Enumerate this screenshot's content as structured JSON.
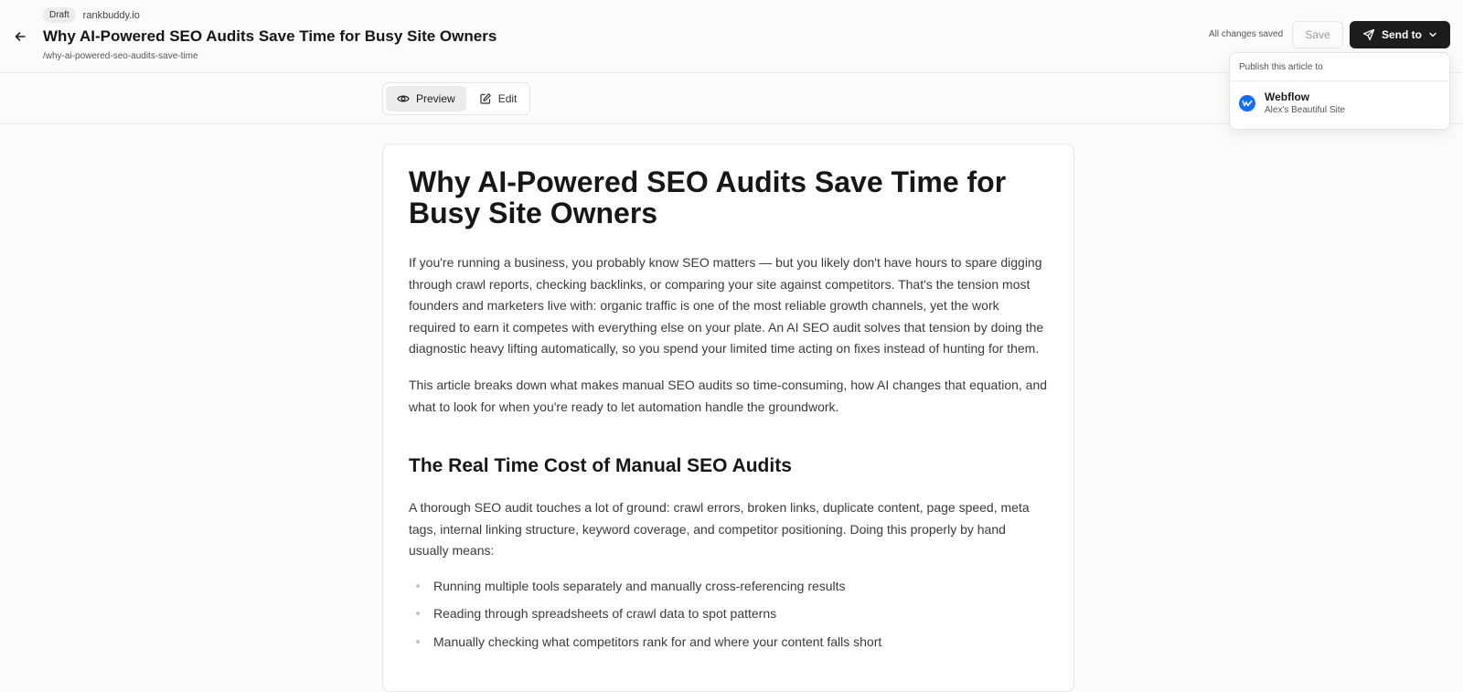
{
  "header": {
    "status_badge": "Draft",
    "domain": "rankbuddy.io",
    "title": "Why AI-Powered SEO Audits Save Time for Busy Site Owners",
    "slug": "/why-ai-powered-seo-audits-save-time",
    "saved_status": "All changes saved",
    "save_label": "Save",
    "send_label": "Send to"
  },
  "view_toggle": {
    "preview_label": "Preview",
    "edit_label": "Edit",
    "active": "Preview"
  },
  "publish_menu": {
    "header": "Publish this article to",
    "items": [
      {
        "name": "Webflow",
        "site": "Alex's Beautiful Site",
        "icon": "webflow-icon"
      }
    ]
  },
  "article": {
    "title": "Why AI-Powered SEO Audits Save Time for Busy Site Owners",
    "intro_p1": "If you're running a business, you probably know SEO matters — but you likely don't have hours to spare digging through crawl reports, checking backlinks, or comparing your site against competitors. That's the tension most founders and marketers live with: organic traffic is one of the most reliable growth channels, yet the work required to earn it competes with everything else on your plate. An AI SEO audit solves that tension by doing the diagnostic heavy lifting automatically, so you spend your limited time acting on fixes instead of hunting for them.",
    "intro_p2": "This article breaks down what makes manual SEO audits so time-consuming, how AI changes that equation, and what to look for when you're ready to let automation handle the groundwork.",
    "section1_heading": "The Real Time Cost of Manual SEO Audits",
    "section1_p1": "A thorough SEO audit touches a lot of ground: crawl errors, broken links, duplicate content, page speed, meta tags, internal linking structure, keyword coverage, and competitor positioning. Doing this properly by hand usually means:",
    "section1_list": [
      "Running multiple tools separately and manually cross-referencing results",
      "Reading through spreadsheets of crawl data to spot patterns",
      "Manually checking what competitors rank for and where your content falls short"
    ]
  },
  "colors": {
    "accent_dark": "#1c1c1c",
    "webflow_blue": "#146ef5",
    "background": "#fbfbf9"
  }
}
